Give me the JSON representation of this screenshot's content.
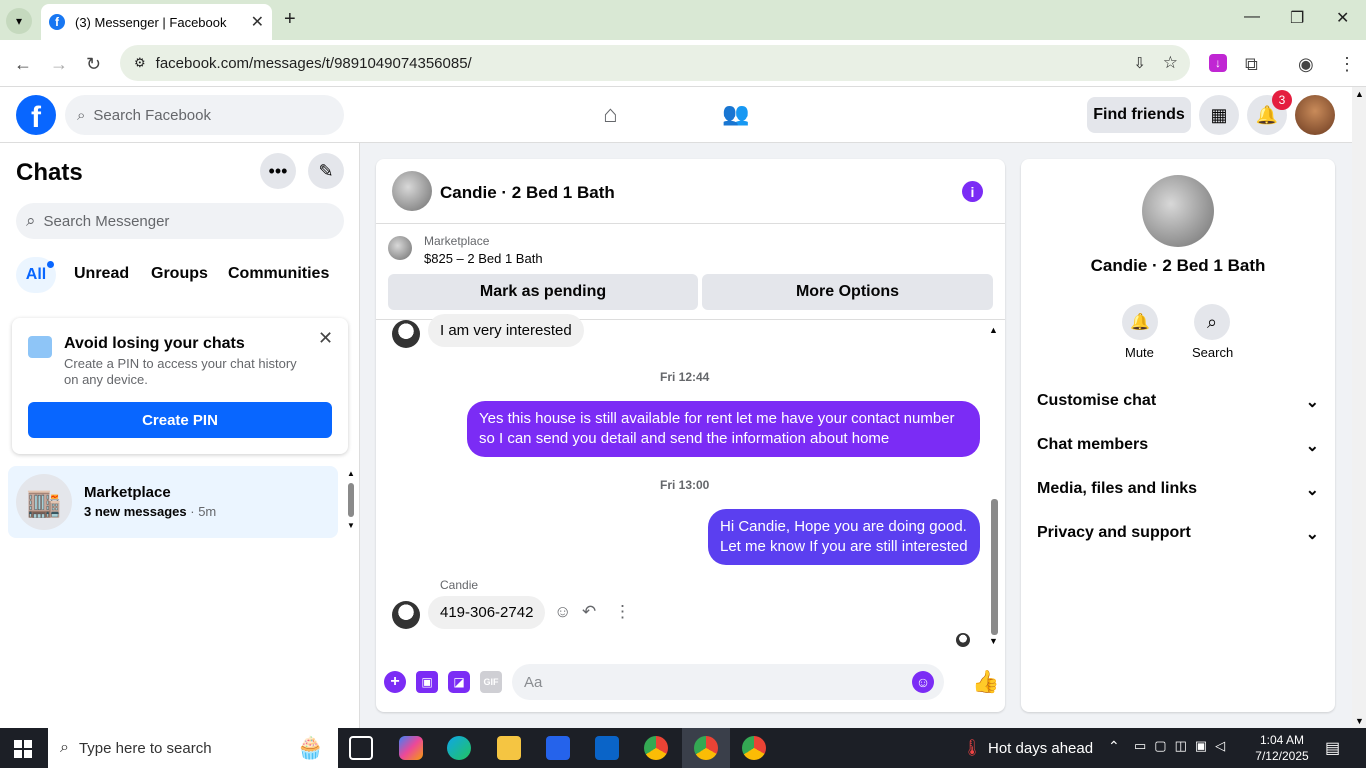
{
  "browser": {
    "tab_title": "(3) Messenger | Facebook",
    "url": "facebook.com/messages/t/9891049074356085/"
  },
  "header": {
    "search_placeholder": "Search Facebook",
    "find_friends": "Find friends",
    "notif_count": "3"
  },
  "sidebar": {
    "title": "Chats",
    "search_placeholder": "Search Messenger",
    "filters": [
      "All",
      "Unread",
      "Groups",
      "Communities"
    ],
    "pin_card": {
      "title": "Avoid losing your chats",
      "body": "Create a PIN to access your chat history on any device.",
      "button": "Create PIN"
    },
    "chat_item": {
      "name": "Marketplace",
      "preview": "3 new messages",
      "time": "· 5m"
    }
  },
  "conversation": {
    "title": "Candie · 2 Bed 1 Bath",
    "marketplace_label": "Marketplace",
    "listing": "$825 – 2 Bed 1 Bath",
    "mark_pending": "Mark as pending",
    "more_options": "More Options",
    "messages": [
      {
        "type": "in",
        "text": "I am very interested"
      },
      {
        "type": "time",
        "text": "Fri 12:44"
      },
      {
        "type": "out",
        "text": "Yes this house is still available for rent let me have your contact number so I can send you detail and send the information about home"
      },
      {
        "type": "time",
        "text": "Fri 13:00"
      },
      {
        "type": "out",
        "text": "Hi Candie, Hope you are doing good. Let me know If you are still interested"
      },
      {
        "type": "sender",
        "text": "Candie"
      },
      {
        "type": "in",
        "text": "419-306-2742"
      }
    ],
    "input_placeholder": "Aa"
  },
  "right_panel": {
    "name": "Candie · 2 Bed 1 Bath",
    "mute": "Mute",
    "search": "Search",
    "sections": [
      "Customise chat",
      "Chat members",
      "Media, files and links",
      "Privacy and support"
    ]
  },
  "taskbar": {
    "search_placeholder": "Type here to search",
    "weather": "Hot days ahead",
    "time": "1:04 AM",
    "date": "7/12/2025"
  },
  "colors": {
    "fb_blue": "#0866ff",
    "message_purple": "#7b2cf5",
    "notification_red": "#e41e3f"
  }
}
